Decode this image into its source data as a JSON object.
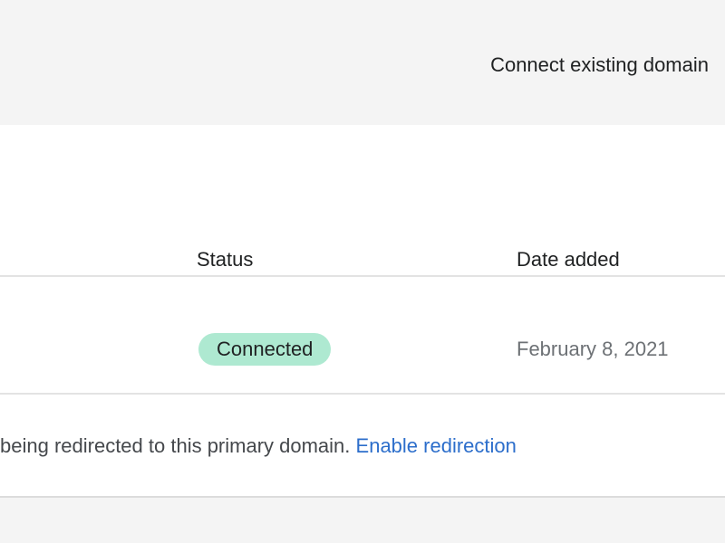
{
  "header": {
    "connect_button_label": "Connect existing domain"
  },
  "table": {
    "columns": {
      "status": "Status",
      "date_added": "Date added"
    },
    "rows": [
      {
        "status": "Connected",
        "date_added": "February 8, 2021"
      }
    ]
  },
  "notice": {
    "text": "being redirected to this primary domain.",
    "link_label": "Enable redirection"
  },
  "colors": {
    "status_badge_bg": "#aee9d1",
    "link": "#2c6ecb",
    "page_bg": "#f4f4f4",
    "card_bg": "#ffffff"
  }
}
